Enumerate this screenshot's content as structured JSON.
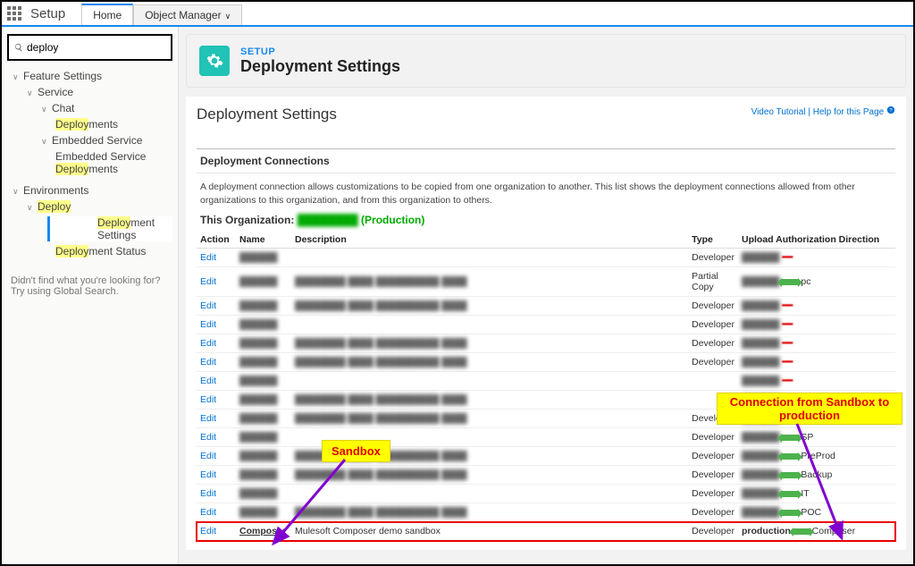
{
  "topbar": {
    "title": "Setup",
    "tab_home": "Home",
    "tab_objmgr": "Object Manager"
  },
  "search": {
    "value": "deploy"
  },
  "tree": {
    "feature_settings": "Feature Settings",
    "service": "Service",
    "chat": "Chat",
    "deployments": "Deployments",
    "embedded_service": "Embedded Service",
    "embedded_item": "Embedded Service Deployments",
    "environments": "Environments",
    "deploy": "Deploy",
    "deploy_settings": "Deployment Settings",
    "deploy_status": "Deployment Status"
  },
  "sidebar_hint": "Didn't find what you're looking for? Try using Global Search.",
  "banner": {
    "label": "SETUP",
    "title": "Deployment Settings"
  },
  "page": {
    "heading": "Deployment Settings",
    "video": "Video Tutorial",
    "help": "Help for this Page",
    "section": "Deployment Connections",
    "desc": "A deployment connection allows customizations to be copied from one organization to another. This list shows the deployment connections allowed from other organizations to this organization, and from this organization to others.",
    "this_org_lbl": "This Organization:",
    "this_org_val": "(Production)"
  },
  "table": {
    "th_action": "Action",
    "th_name": "Name",
    "th_desc": "Description",
    "th_type": "Type",
    "th_upload": "Upload Authorization Direction",
    "edit": "Edit"
  },
  "rows": [
    {
      "type": "Developer",
      "upload_dir": ""
    },
    {
      "type": "Partial Copy",
      "upload_dir": "pc"
    },
    {
      "type": "Developer",
      "upload_dir": ""
    },
    {
      "type": "Developer",
      "upload_dir": ""
    },
    {
      "type": "Developer",
      "upload_dir": ""
    },
    {
      "type": "Developer",
      "upload_dir": ""
    },
    {
      "type": "",
      "upload_dir": ""
    },
    {
      "type": "",
      "upload_dir": ""
    },
    {
      "type": "Developer",
      "upload_dir": ""
    },
    {
      "type": "Developer",
      "upload_dir": "SP"
    },
    {
      "type": "Developer",
      "upload_dir": "PreProd"
    },
    {
      "type": "Developer",
      "upload_dir": "Backup"
    },
    {
      "type": "Developer",
      "upload_dir": "IT"
    },
    {
      "type": "Developer",
      "upload_dir": "POC"
    }
  ],
  "highlight_row": {
    "name": "Composer",
    "desc": "Mulesoft Composer demo sandbox",
    "type": "Developer",
    "upload": "production",
    "dir": "Composer"
  },
  "annots": {
    "sandbox": "Sandbox",
    "connection": "Connection from Sandbox to production"
  }
}
